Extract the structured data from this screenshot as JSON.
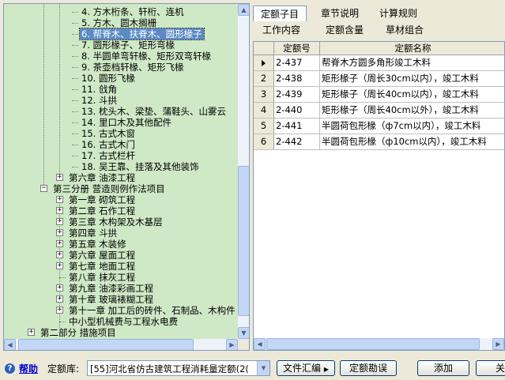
{
  "tree": {
    "nodes": [
      {
        "label": "4. 方木桁条、轩桁、连机",
        "depth": 4
      },
      {
        "label": "5. 方木、圆木搁栅",
        "depth": 4
      },
      {
        "label": "6. 帮脊木、扶脊木、圆形椽子",
        "depth": 4,
        "selected": true
      },
      {
        "label": "7. 圆形椽子、矩形弯椽",
        "depth": 4
      },
      {
        "label": "8. 半圆单弯轩椽、矩形双弯轩椽",
        "depth": 4
      },
      {
        "label": "9. 茶壶档轩椽、矩形飞椽",
        "depth": 4
      },
      {
        "label": "10. 圆形飞椽",
        "depth": 4
      },
      {
        "label": "11. 戗角",
        "depth": 4
      },
      {
        "label": "12. 斗拱",
        "depth": 4
      },
      {
        "label": "13. 枕头木、梁垫、蒲鞋头、山雾云",
        "depth": 4
      },
      {
        "label": "14. 里口木及其他配件",
        "depth": 4
      },
      {
        "label": "15. 古式木窗",
        "depth": 4
      },
      {
        "label": "16. 古式木门",
        "depth": 4
      },
      {
        "label": "17. 古式栏杆",
        "depth": 4
      },
      {
        "label": "18. 吴王靠、挂落及其他装饰",
        "depth": 4
      },
      {
        "label": "第六章 油漆工程",
        "depth": 3,
        "expander": "+"
      },
      {
        "label": "第三分册 营造则例作法项目",
        "depth": 2,
        "expander": "−"
      },
      {
        "label": "第一章 砌筑工程",
        "depth": 3,
        "expander": "+"
      },
      {
        "label": "第二章 石作工程",
        "depth": 3,
        "expander": "+"
      },
      {
        "label": "第三章 木构架及木基层",
        "depth": 3,
        "expander": "+"
      },
      {
        "label": "第四章 斗拱",
        "depth": 3,
        "expander": "+"
      },
      {
        "label": "第五章 木装修",
        "depth": 3,
        "expander": "+"
      },
      {
        "label": "第六章 屋面工程",
        "depth": 3,
        "expander": "+"
      },
      {
        "label": "第七章 地面工程",
        "depth": 3,
        "expander": "+"
      },
      {
        "label": "第八章 抹灰工程",
        "depth": 3
      },
      {
        "label": "第九章 油漆彩画工程",
        "depth": 3,
        "expander": "+"
      },
      {
        "label": "第十章 玻璃裱糊工程",
        "depth": 3,
        "expander": "+"
      },
      {
        "label": "第十一章 加工后的砖件、石制品、木构件",
        "depth": 3,
        "expander": "+"
      },
      {
        "label": "中小型机械费与工程水电费",
        "depth": 3
      },
      {
        "label": "第二部分 措施项目",
        "depth": 1,
        "expander": "+"
      }
    ]
  },
  "tabs": {
    "row1": [
      "定额子目",
      "章节说明",
      "计算规则"
    ],
    "row2": [
      "工作内容",
      "定额含量",
      "草材组合"
    ],
    "active": "定额子目"
  },
  "grid": {
    "columns": [
      "定额号",
      "定额名称"
    ],
    "rows": [
      {
        "index": "",
        "code": "2-437",
        "name": "帮脊木方圆多角形竣工木料"
      },
      {
        "index": "2",
        "code": "2-438",
        "name": "矩形椽子（周长30cm以内），竣工木料"
      },
      {
        "index": "3",
        "code": "2-439",
        "name": "矩形椽子（周长40cm以内），竣工木料"
      },
      {
        "index": "4",
        "code": "2-440",
        "name": "矩形椽子（周长40cm以外），竣工木料"
      },
      {
        "index": "5",
        "code": "2-441",
        "name": "半圆荷包形椽（ф7cm以内），竣工木料"
      },
      {
        "index": "6",
        "code": "2-442",
        "name": "半圆荷包形椽（ф10cm以内），竣工木料"
      }
    ]
  },
  "bottom": {
    "help": "帮助",
    "library_label": "定额库:",
    "library_value": "[55]河北省仿古建筑工程消耗量定额(2(",
    "file_button": "文件汇编",
    "survey_button": "定额勘误",
    "add_button": "添加",
    "close_button": "关"
  },
  "colors": {
    "tree_bg": "#cfe8c6",
    "selected_bg": "#5b8ac6",
    "link": "#0000cc"
  }
}
